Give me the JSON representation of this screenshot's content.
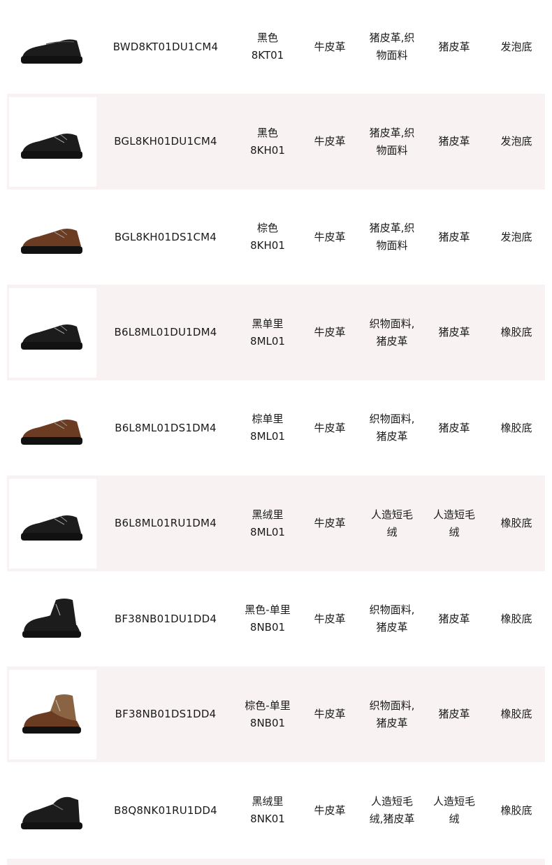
{
  "products": [
    {
      "code": "BWD8KT01DU1CM4",
      "color": [
        "黑色",
        "8KT01"
      ],
      "upper": "牛皮革",
      "lining": [
        "猪皮革,织",
        "物面料"
      ],
      "sock": [
        "猪皮革"
      ],
      "sole": "发泡底",
      "shoe": "slip-on",
      "tone": "black"
    },
    {
      "code": "BGL8KH01DU1CM4",
      "color": [
        "黑色",
        "8KH01"
      ],
      "upper": "牛皮革",
      "lining": [
        "猪皮革,织",
        "物面料"
      ],
      "sock": [
        "猪皮革"
      ],
      "sole": "发泡底",
      "shoe": "derby",
      "tone": "black"
    },
    {
      "code": "BGL8KH01DS1CM4",
      "color": [
        "棕色",
        "8KH01"
      ],
      "upper": "牛皮革",
      "lining": [
        "猪皮革,织",
        "物面料"
      ],
      "sock": [
        "猪皮革"
      ],
      "sole": "发泡底",
      "shoe": "derby",
      "tone": "brown"
    },
    {
      "code": "B6L8ML01DU1DM4",
      "color": [
        "黑单里",
        "8ML01"
      ],
      "upper": "牛皮革",
      "lining": [
        "织物面料,",
        "猪皮革"
      ],
      "sock": [
        "猪皮革"
      ],
      "sole": "橡胶底",
      "shoe": "derby",
      "tone": "black"
    },
    {
      "code": "B6L8ML01DS1DM4",
      "color": [
        "棕单里",
        "8ML01"
      ],
      "upper": "牛皮革",
      "lining": [
        "织物面料,",
        "猪皮革"
      ],
      "sock": [
        "猪皮革"
      ],
      "sole": "橡胶底",
      "shoe": "derby",
      "tone": "brown"
    },
    {
      "code": "B6L8ML01RU1DM4",
      "color": [
        "黑绒里",
        "8ML01"
      ],
      "upper": "牛皮革",
      "lining": [
        "人造短毛",
        "绒"
      ],
      "sock": [
        "人造短毛",
        "绒"
      ],
      "sole": "橡胶底",
      "shoe": "derby",
      "tone": "black"
    },
    {
      "code": "BF38NB01DU1DD4",
      "color": [
        "黑色-单里",
        "8NB01"
      ],
      "upper": "牛皮革",
      "lining": [
        "织物面料,",
        "猪皮革"
      ],
      "sock": [
        "猪皮革"
      ],
      "sole": "橡胶底",
      "shoe": "boot",
      "tone": "black"
    },
    {
      "code": "BF38NB01DS1DD4",
      "color": [
        "棕色-单里",
        "8NB01"
      ],
      "upper": "牛皮革",
      "lining": [
        "织物面料,",
        "猪皮革"
      ],
      "sock": [
        "猪皮革"
      ],
      "sole": "橡胶底",
      "shoe": "boot",
      "tone": "brown"
    },
    {
      "code": "B8Q8NK01RU1DD4",
      "color": [
        "黑绒里",
        "8NK01"
      ],
      "upper": "牛皮革",
      "lining": [
        "人造短毛",
        "绒,猪皮革"
      ],
      "sock": [
        "人造短毛",
        "绒"
      ],
      "sole": "橡胶底",
      "shoe": "lowboot",
      "tone": "black"
    }
  ],
  "colors": {
    "row_shade": "#f8f2f2",
    "text": "#1a1a1a",
    "leather_black": "#1c1c1c",
    "leather_brown": "#6b3b22",
    "suede_tan": "#8a6442",
    "sole": "#111111"
  }
}
